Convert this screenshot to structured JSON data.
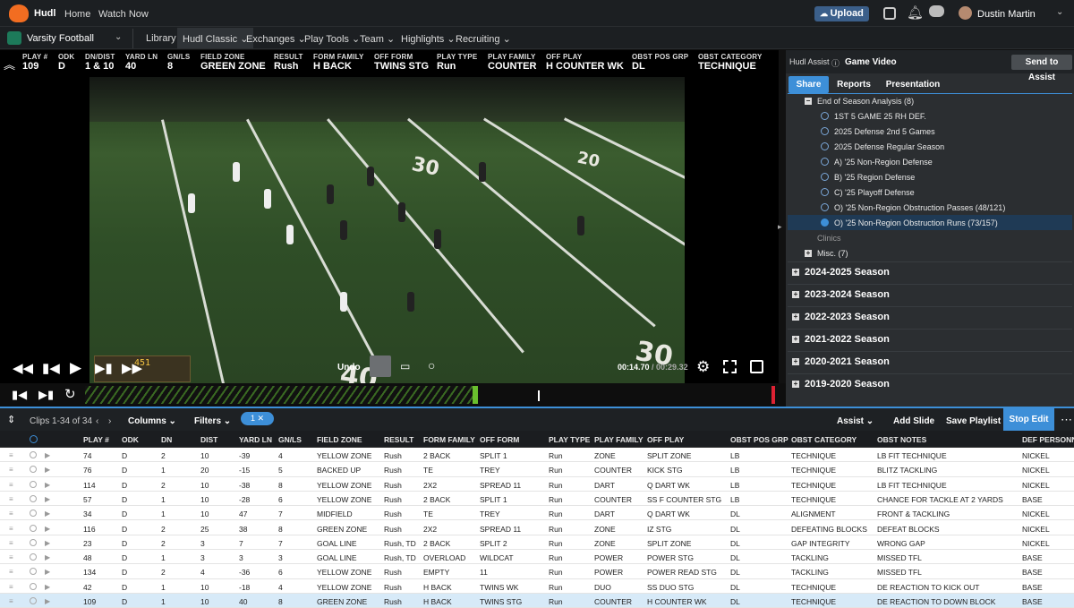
{
  "topbar": {
    "brand": "Hudl",
    "nav": [
      "Home",
      "Watch Now"
    ],
    "upload_label": "Upload",
    "user_name": "Dustin Martin"
  },
  "secondary": {
    "team": "Varsity Football",
    "nav": [
      "Library",
      "Hudl Classic",
      "Exchanges",
      "Play Tools",
      "Team",
      "Highlights",
      "Recruiting"
    ],
    "active": "Hudl Classic"
  },
  "hud": [
    {
      "label": "PLAY #",
      "value": "109"
    },
    {
      "label": "ODK",
      "value": "D"
    },
    {
      "label": "DN/DIST",
      "value": "1 & 10"
    },
    {
      "label": "YARD LN",
      "value": "40"
    },
    {
      "label": "GN/LS",
      "value": "8"
    },
    {
      "label": "FIELD ZONE",
      "value": "GREEN ZONE"
    },
    {
      "label": "RESULT",
      "value": "Rush"
    },
    {
      "label": "FORM FAMILY",
      "value": "H BACK"
    },
    {
      "label": "OFF FORM",
      "value": "TWINS STG"
    },
    {
      "label": "PLAY TYPE",
      "value": "Run"
    },
    {
      "label": "PLAY FAMILY",
      "value": "COUNTER"
    },
    {
      "label": "OFF PLAY",
      "value": "H COUNTER WK"
    },
    {
      "label": "OBST POS GRP",
      "value": "DL"
    },
    {
      "label": "OBST CATEGORY",
      "value": "TECHNIQUE"
    }
  ],
  "field_numbers": [
    "30",
    "20",
    "40",
    "30"
  ],
  "video": {
    "undo_label": "Undo",
    "time_current": "00:14.70",
    "time_total": "00:29.32",
    "scoreboard": "451"
  },
  "sidebar": {
    "assist_label": "Hudl Assist",
    "section_title": "Game Video",
    "send_label": "Send to Assist",
    "tabs": [
      "Share",
      "Reports",
      "Presentation"
    ],
    "active_tab": "Share",
    "folder": "End of Season Analysis (8)",
    "items": [
      "1ST 5 GAME 25 RH DEF.",
      "2025 Defense 2nd 5 Games",
      "2025 Defense Regular Season",
      "A) '25 Non-Region Defense",
      "B) '25 Region Defense",
      "C) '25 Playoff Defense",
      "O) '25 Non-Region Obstruction Passes (48/121)",
      "O) '25 Non-Region Obstruction Runs (73/157)"
    ],
    "selected_item": "O) '25 Non-Region Obstruction Runs (73/157)",
    "clinics": "Clinics",
    "misc": "Misc. (7)",
    "seasons": [
      "2024-2025 Season",
      "2023-2024 Season",
      "2022-2023 Season",
      "2021-2022 Season",
      "2020-2021 Season",
      "2019-2020 Season"
    ]
  },
  "grid": {
    "clips_label": "Clips 1-34 of 34",
    "columns_label": "Columns",
    "filters_label": "Filters",
    "filter_count": "1",
    "assist_label": "Assist",
    "add_slide": "Add Slide",
    "save_playlist": "Save Playlist",
    "stop_edit": "Stop Edit",
    "headers": [
      "PLAY #",
      "ODK",
      "DN",
      "DIST",
      "YARD LN",
      "GN/LS",
      "FIELD ZONE",
      "RESULT",
      "FORM FAMILY",
      "OFF FORM",
      "PLAY TYPE",
      "PLAY FAMILY",
      "OFF PLAY",
      "OBST POS GRP",
      "OBST CATEGORY",
      "OBST NOTES",
      "DEF PERSONN"
    ],
    "rows": [
      [
        "74",
        "D",
        "2",
        "10",
        "-39",
        "4",
        "YELLOW ZONE",
        "Rush",
        "2 BACK",
        "SPLIT 1",
        "Run",
        "ZONE",
        "SPLIT ZONE",
        "LB",
        "TECHNIQUE",
        "LB FIT TECHNIQUE",
        "NICKEL"
      ],
      [
        "76",
        "D",
        "1",
        "20",
        "-15",
        "5",
        "BACKED UP",
        "Rush",
        "TE",
        "TREY",
        "Run",
        "COUNTER",
        "KICK STG",
        "LB",
        "TECHNIQUE",
        "BLITZ TACKLING",
        "NICKEL"
      ],
      [
        "114",
        "D",
        "2",
        "10",
        "-38",
        "8",
        "YELLOW ZONE",
        "Rush",
        "2X2",
        "SPREAD 11",
        "Run",
        "DART",
        "Q DART WK",
        "LB",
        "TECHNIQUE",
        "LB FIT TECHNIQUE",
        "NICKEL"
      ],
      [
        "57",
        "D",
        "1",
        "10",
        "-28",
        "6",
        "YELLOW ZONE",
        "Rush",
        "2 BACK",
        "SPLIT 1",
        "Run",
        "COUNTER",
        "SS F COUNTER STG",
        "LB",
        "TECHNIQUE",
        "CHANCE FOR TACKLE AT 2 YARDS",
        "BASE"
      ],
      [
        "34",
        "D",
        "1",
        "10",
        "47",
        "7",
        "MIDFIELD",
        "Rush",
        "TE",
        "TREY",
        "Run",
        "DART",
        "Q DART WK",
        "DL",
        "ALIGNMENT",
        "FRONT & TACKLING",
        "NICKEL"
      ],
      [
        "116",
        "D",
        "2",
        "25",
        "38",
        "8",
        "GREEN ZONE",
        "Rush",
        "2X2",
        "SPREAD 11",
        "Run",
        "ZONE",
        "IZ STG",
        "DL",
        "DEFEATING BLOCKS",
        "DEFEAT BLOCKS",
        "NICKEL"
      ],
      [
        "23",
        "D",
        "2",
        "3",
        "7",
        "7",
        "GOAL LINE",
        "Rush, TD",
        "2 BACK",
        "SPLIT 2",
        "Run",
        "ZONE",
        "SPLIT ZONE",
        "DL",
        "GAP INTEGRITY",
        "WRONG GAP",
        "NICKEL"
      ],
      [
        "48",
        "D",
        "1",
        "3",
        "3",
        "3",
        "GOAL LINE",
        "Rush, TD",
        "OVERLOAD",
        "WILDCAT",
        "Run",
        "POWER",
        "POWER STG",
        "DL",
        "TACKLING",
        "MISSED TFL",
        "BASE"
      ],
      [
        "134",
        "D",
        "2",
        "4",
        "-36",
        "6",
        "YELLOW ZONE",
        "Rush",
        "EMPTY",
        "11",
        "Run",
        "POWER",
        "POWER READ STG",
        "DL",
        "TACKLING",
        "MISSED TFL",
        "BASE"
      ],
      [
        "42",
        "D",
        "1",
        "10",
        "-18",
        "4",
        "YELLOW ZONE",
        "Rush",
        "H BACK",
        "TWINS WK",
        "Run",
        "DUO",
        "SS DUO STG",
        "DL",
        "TECHNIQUE",
        "DE REACTION TO KICK OUT",
        "BASE"
      ],
      [
        "109",
        "D",
        "1",
        "10",
        "40",
        "8",
        "GREEN ZONE",
        "Rush",
        "H BACK",
        "TWINS STG",
        "Run",
        "COUNTER",
        "H COUNTER WK",
        "DL",
        "TECHNIQUE",
        "DE REACTION TO DOWN BLOCK",
        "BASE"
      ]
    ],
    "selected_row": 10
  }
}
